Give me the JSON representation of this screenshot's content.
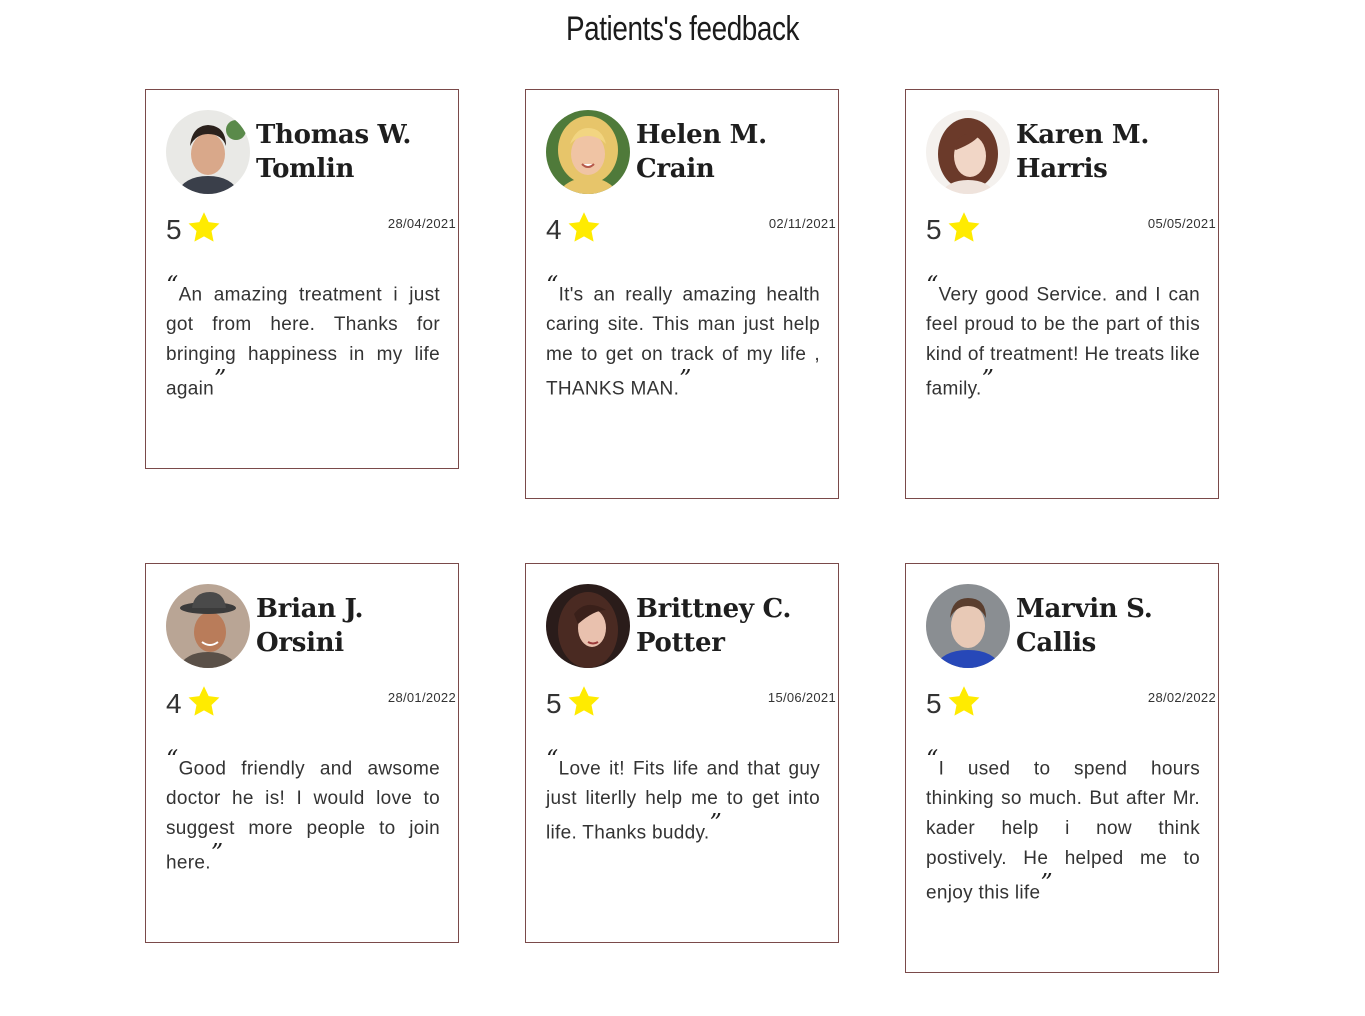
{
  "page": {
    "title": "Patients's feedback"
  },
  "colors": {
    "star": "#ffeb00",
    "border": "#7a4a4a"
  },
  "cards": [
    {
      "name_line1": "Thomas W.",
      "name_line2": "Tomlin",
      "rating": "5",
      "date": "28/04/2021",
      "comment": "An amazing treatment i just got from here. Thanks for bringing happiness in my life again",
      "open_quote": "“",
      "close_quote": "”"
    },
    {
      "name_line1": "Helen M.",
      "name_line2": "Crain",
      "rating": "4",
      "date": "02/11/2021",
      "comment": "It's an really amazing health caring site. This man just help me to get on track of my life , THANKS MAN.",
      "open_quote": "“",
      "close_quote": "”"
    },
    {
      "name_line1": "Karen M.",
      "name_line2": "Harris",
      "rating": "5",
      "date": "05/05/2021",
      "comment": "Very good Service. and I can feel proud to be the part of this kind of treatment! He treats like family.",
      "open_quote": "“",
      "close_quote": "”"
    },
    {
      "name_line1": "Brian J.",
      "name_line2": "Orsini",
      "rating": "4",
      "date": "28/01/2022",
      "comment": "Good friendly and awsome doctor he is! I would love to suggest more people to join here.",
      "open_quote": "“",
      "close_quote": "”"
    },
    {
      "name_line1": "Brittney C.",
      "name_line2": "Potter",
      "rating": "5",
      "date": "15/06/2021",
      "comment": "Love it! Fits life and that guy just literlly help me to get into life. Thanks buddy.",
      "open_quote": "“",
      "close_quote": "”"
    },
    {
      "name_line1": "Marvin S.",
      "name_line2": "Callis",
      "rating": "5",
      "date": "28/02/2022",
      "comment": "I used to spend hours thinking so much. But after Mr. kader help i now think postively. He helped me to enjoy this life",
      "open_quote": "“",
      "close_quote": "”"
    }
  ]
}
